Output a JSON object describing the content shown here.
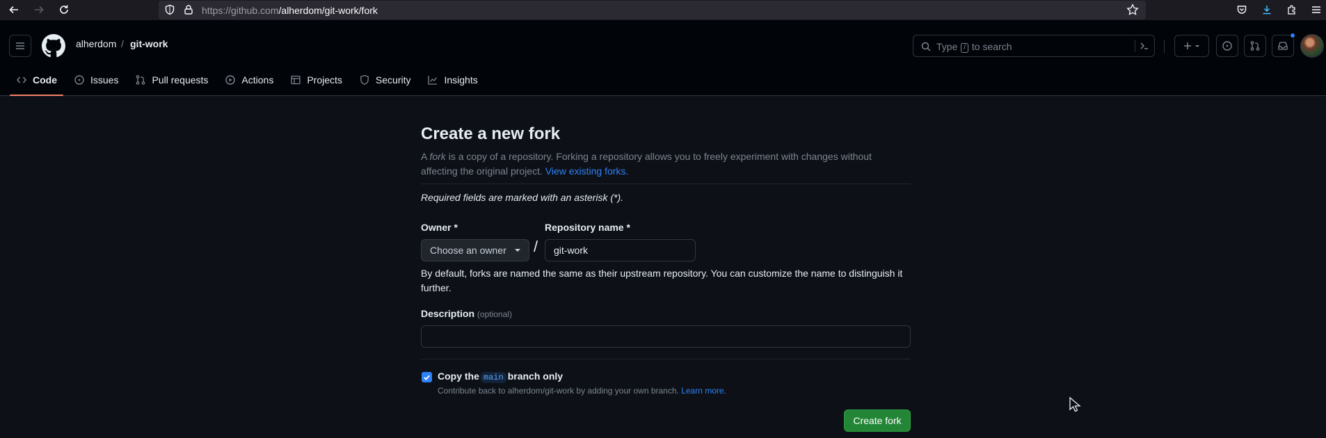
{
  "browser": {
    "url_host": "https://github.com",
    "url_path": "/alherdom/git-work/fork"
  },
  "header": {
    "owner": "alherdom",
    "separator": "/",
    "repo": "git-work",
    "search_prefix": "Type",
    "search_key": "/",
    "search_suffix": "to search"
  },
  "tabs": [
    {
      "label": "Code",
      "icon": "code-icon",
      "active": true
    },
    {
      "label": "Issues",
      "icon": "issue-icon"
    },
    {
      "label": "Pull requests",
      "icon": "pull-request-icon"
    },
    {
      "label": "Actions",
      "icon": "play-icon"
    },
    {
      "label": "Projects",
      "icon": "table-icon"
    },
    {
      "label": "Security",
      "icon": "shield-icon"
    },
    {
      "label": "Insights",
      "icon": "graph-icon"
    }
  ],
  "form": {
    "title": "Create a new fork",
    "intro_a": "A ",
    "intro_fork": "fork",
    "intro_b": " is a copy of a repository. Forking a repository allows you to freely experiment with changes without affecting the original project. ",
    "intro_link": "View existing forks.",
    "required_note": "Required fields are marked with an asterisk (*).",
    "owner_label": "Owner *",
    "owner_value": "Choose an owner",
    "slash": "/",
    "repo_label": "Repository name *",
    "repo_value": "git-work",
    "name_help": "By default, forks are named the same as their upstream repository. You can customize the name to distinguish it further.",
    "description_label": "Description",
    "description_optional": "(optional)",
    "description_value": "",
    "copy_prefix": "Copy the",
    "copy_branch": "main",
    "copy_suffix": "branch only",
    "copy_checked": true,
    "copy_help": "Contribute back to alherdom/git-work by adding your own branch.",
    "learn_more": "Learn more.",
    "submit": "Create fork"
  },
  "colors": {
    "accent": "#2f81f7",
    "primary_button": "#238636",
    "active_tab_underline": "#f78166"
  }
}
